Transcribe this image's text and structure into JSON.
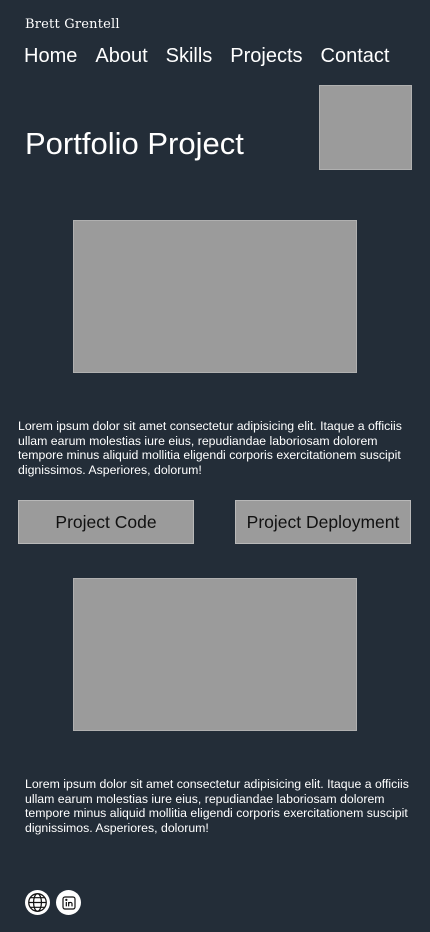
{
  "header": {
    "brand": "Brett Grentell",
    "nav": [
      "Home",
      "About",
      "Skills",
      "Projects",
      "Contact"
    ]
  },
  "hero": {
    "title": "Portfolio Project"
  },
  "content": {
    "paragraph_1": "Lorem ipsum dolor sit amet consectetur adipisicing elit. Itaque a officiis ullam earum molestias iure eius, repudiandae laboriosam dolorem tempore minus aliquid mollitia eligendi corporis exercitationem suscipit dignissimos. Asperiores, dolorum!",
    "paragraph_2": "Lorem ipsum dolor sit amet consectetur adipisicing elit. Itaque a officiis ullam earum molestias iure eius, repudiandae laboriosam dolorem tempore minus aliquid mollitia eligendi corporis exercitationem suscipit dignissimos. Asperiores, dolorum!"
  },
  "buttons": {
    "code_label": "Project Code",
    "deploy_label": "Project Deployment"
  },
  "footer": {
    "icons": [
      "globe-icon",
      "linkedin-icon"
    ]
  },
  "colors": {
    "background": "#232d38",
    "placeholder": "#9b9b9b",
    "text": "#ffffff",
    "button_text": "#111111"
  }
}
